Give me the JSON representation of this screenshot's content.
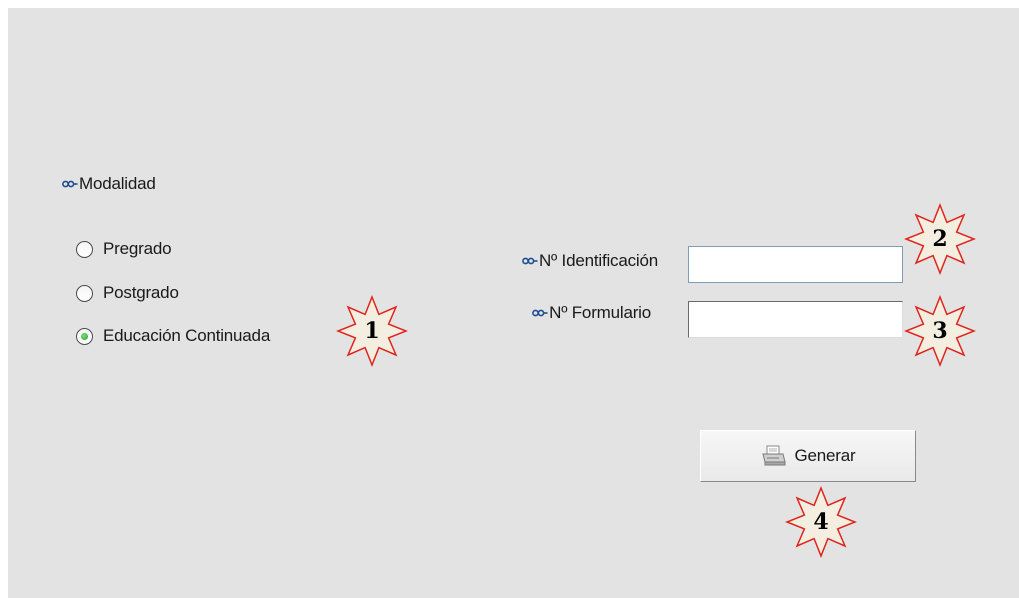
{
  "modalidad": {
    "label": "Modalidad",
    "options": [
      {
        "label": "Pregrado",
        "checked": false
      },
      {
        "label": "Postgrado",
        "checked": false
      },
      {
        "label": "Educación Continuada",
        "checked": true
      }
    ]
  },
  "fields": {
    "identificacion": {
      "label": "Nº Identificación",
      "value": ""
    },
    "formulario": {
      "label": "Nº Formulario",
      "value": ""
    }
  },
  "generate_button": {
    "label": "Generar",
    "icon": "printer-icon"
  },
  "annotations": [
    "1",
    "2",
    "3",
    "4"
  ],
  "colors": {
    "panel_bg": "#e3e3e3",
    "badge_fill": "#f3eee0",
    "badge_stroke": "#e0241c",
    "radio_checked": "#2a9a2a",
    "info_icon": "#1e4d8f"
  }
}
